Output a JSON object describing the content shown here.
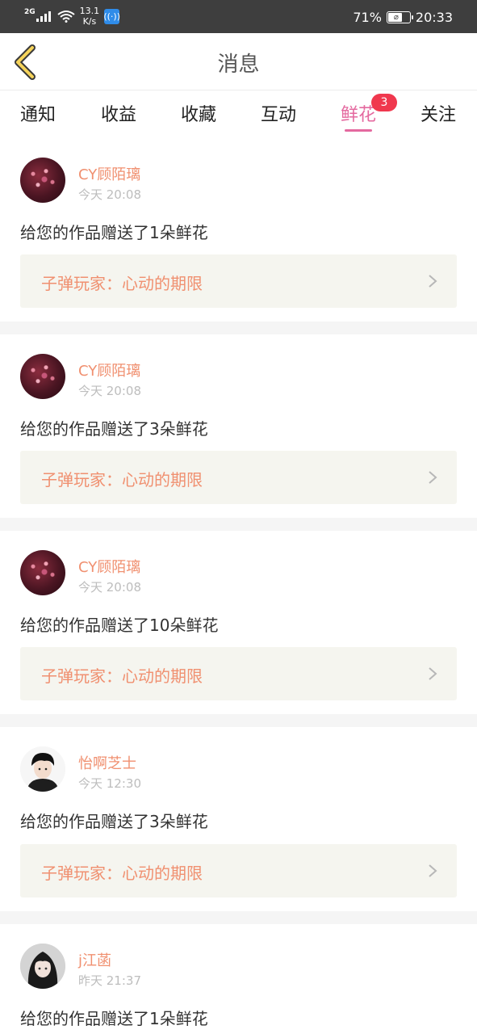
{
  "status_bar": {
    "network": "2G",
    "speed_value": "13.1",
    "speed_unit": "K/s",
    "battery_percent": "71%",
    "battery_level": 0.71,
    "time": "20:33",
    "icons": [
      "signal-icon",
      "wifi-icon",
      "nfc-icon",
      "battery-icon"
    ]
  },
  "header": {
    "title": "消息",
    "back_icon": "chevron-left-icon",
    "accent_color": "#f5d35a"
  },
  "tabs": [
    {
      "label": "通知",
      "active": false
    },
    {
      "label": "收益",
      "active": false
    },
    {
      "label": "收藏",
      "active": false
    },
    {
      "label": "互动",
      "active": false
    },
    {
      "label": "鲜花",
      "active": true,
      "badge": "3"
    },
    {
      "label": "关注",
      "active": false
    }
  ],
  "messages": [
    {
      "user": "CY顾陌璃",
      "time": "今天 20:08",
      "text": "给您的作品赠送了1朵鲜花",
      "work": "子弹玩家：心动的期限"
    },
    {
      "user": "CY顾陌璃",
      "time": "今天 20:08",
      "text": "给您的作品赠送了3朵鲜花",
      "work": "子弹玩家：心动的期限"
    },
    {
      "user": "CY顾陌璃",
      "time": "今天 20:08",
      "text": "给您的作品赠送了10朵鲜花",
      "work": "子弹玩家：心动的期限"
    },
    {
      "user": "怡啊芝士",
      "time": "今天 12:30",
      "text": "给您的作品赠送了3朵鲜花",
      "work": "子弹玩家：心动的期限"
    },
    {
      "user": "j江菡",
      "time": "昨天 21:37",
      "text": "给您的作品赠送了1朵鲜花",
      "work": ""
    }
  ],
  "colors": {
    "active_tab": "#e4699f",
    "badge": "#f0384e",
    "username": "#f09070",
    "work_card_bg": "#f5f5ef"
  }
}
